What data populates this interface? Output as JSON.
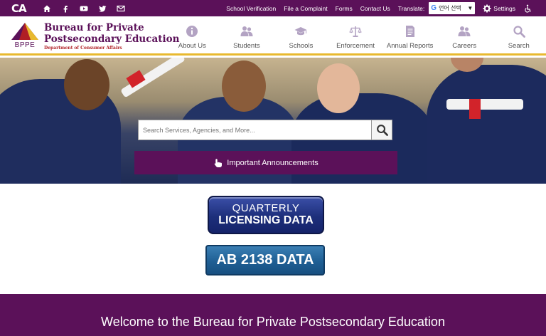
{
  "util": {
    "logo": "CA",
    "links": [
      "School Verification",
      "File a Complaint",
      "Forms",
      "Contact Us"
    ],
    "translate_label": "Translate:",
    "language_value": "언어 선택",
    "settings_label": "Settings"
  },
  "brand": {
    "abbr": "BPPE",
    "line1": "Bureau for Private",
    "line2": "Postsecondary Education",
    "sub": "Department of Consumer Affairs"
  },
  "nav": [
    {
      "label": "About Us",
      "icon": "info-icon"
    },
    {
      "label": "Students",
      "icon": "people-icon"
    },
    {
      "label": "Schools",
      "icon": "graduation-cap-icon"
    },
    {
      "label": "Enforcement",
      "icon": "scales-icon"
    },
    {
      "label": "Annual Reports",
      "icon": "document-icon"
    },
    {
      "label": "Careers",
      "icon": "people-icon"
    },
    {
      "label": "Search",
      "icon": "search-icon"
    }
  ],
  "hero": {
    "search_placeholder": "Search Services, Agencies, and More...",
    "announcements_label": "Important Announcements"
  },
  "buttons": {
    "quarterly_line1": "QUARTERLY",
    "quarterly_line2": "LICENSING DATA",
    "ab2138": "AB 2138 DATA"
  },
  "welcome": "Welcome to the Bureau for Private Postsecondary Education",
  "colors": {
    "brand_purple": "#5b1159",
    "accent_gold": "#e8b92f",
    "title_red": "#b01f25"
  }
}
